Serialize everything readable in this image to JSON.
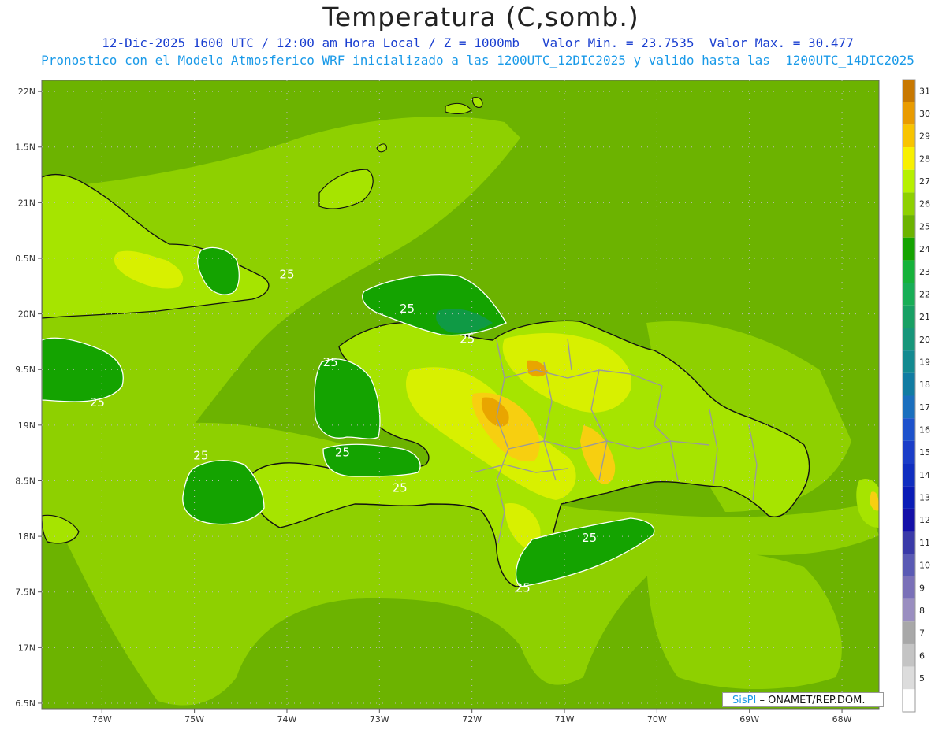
{
  "title": "Temperatura (C,somb.)",
  "subtitle_line1": "12-Dic-2025 1600 UTC / 12:00 am Hora Local / Z = 1000mb   Valor Min. = 23.7535  Valor Max. = 30.477",
  "subtitle_line2": "Pronostico con el Modelo Atmosferico WRF inicializado a las 1200UTC_12DIC2025 y valido hasta las  1200UTC_14DIC2025",
  "credit": {
    "brand": "SisPI",
    "separator": " – ",
    "org": "ONAMET/REP.DOM."
  },
  "colors": {
    "sea_base": "#6cb300",
    "band_26": "#8ed000",
    "band_27": "#a6e400",
    "band_28": "#d8f000",
    "band_29": "#f7cf10",
    "band_30": "#e9a500",
    "band_25": "#14a300",
    "band_24_dark": "#0f9a45",
    "coast": "#111111",
    "contour": "#ffffff",
    "border": "#9a9a9a",
    "grid": "#bbbbbb"
  },
  "map_data": {
    "lon_range": [
      -76.65,
      -67.6
    ],
    "lat_range": [
      16.45,
      22.1
    ],
    "lon_ticks": [
      -76,
      -75,
      -74,
      -73,
      -72,
      -71,
      -70,
      -69,
      -68
    ],
    "lon_tick_labels": [
      "76W",
      "75W",
      "74W",
      "73W",
      "72W",
      "71W",
      "70W",
      "69W",
      "68W"
    ],
    "lat_ticks": [
      16.5,
      17,
      17.5,
      18,
      18.5,
      19,
      19.5,
      20,
      20.5,
      21,
      21.5,
      22
    ],
    "lat_tick_labels": [
      "6.5N",
      "17N",
      "7.5N",
      "18N",
      "8.5N",
      "19N",
      "9.5N",
      "20N",
      "0.5N",
      "21N",
      "1.5N",
      "22N"
    ],
    "contour_labels": [
      {
        "text": "25",
        "lon": -72.7,
        "lat": 20.01
      },
      {
        "text": "25",
        "lon": -72.05,
        "lat": 19.74
      },
      {
        "text": "25",
        "lon": -73.53,
        "lat": 19.53
      },
      {
        "text": "25",
        "lon": -76.05,
        "lat": 19.17
      },
      {
        "text": "25",
        "lon": -74.0,
        "lat": 20.32
      },
      {
        "text": "25",
        "lon": -73.4,
        "lat": 18.72
      },
      {
        "text": "25",
        "lon": -74.93,
        "lat": 18.69
      },
      {
        "text": "25",
        "lon": -72.78,
        "lat": 18.4
      },
      {
        "text": "25",
        "lon": -70.73,
        "lat": 17.95
      },
      {
        "text": "25",
        "lon": -71.45,
        "lat": 17.5
      }
    ]
  },
  "legend": {
    "levels": [
      31,
      30,
      29,
      28,
      27,
      26,
      25,
      24,
      23,
      22,
      21,
      20,
      19,
      18,
      17,
      16,
      15,
      14,
      13,
      12,
      11,
      10,
      9,
      8,
      7,
      6,
      5
    ],
    "colors": [
      "#c87800",
      "#e99b00",
      "#f8c400",
      "#f8f000",
      "#b6f000",
      "#8ed000",
      "#6cb300",
      "#14a300",
      "#16b23a",
      "#18ae56",
      "#18a064",
      "#17967a",
      "#138a90",
      "#117ca2",
      "#1a6fbe",
      "#1d52cc",
      "#1a3dc8",
      "#102ec0",
      "#0a1cb6",
      "#1410a8",
      "#3a3aa8",
      "#5a5ab4",
      "#7a70b8",
      "#9a8ec0",
      "#a8a8a8",
      "#c4c4c4",
      "#dcdcdc",
      "#ffffff"
    ]
  }
}
